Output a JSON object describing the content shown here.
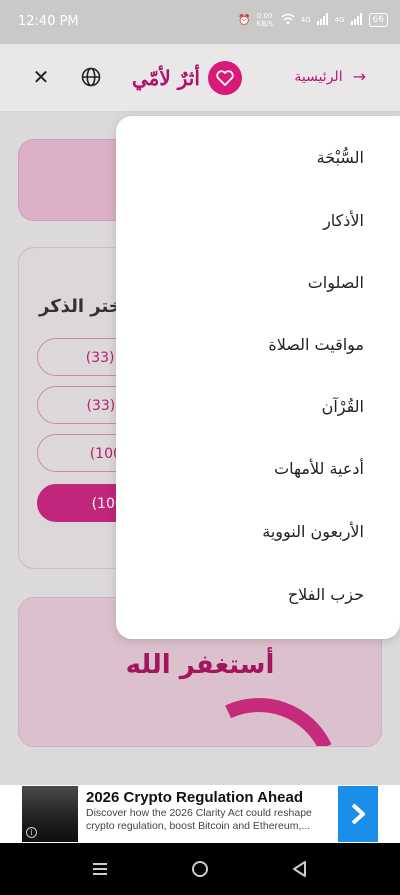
{
  "status_bar": {
    "time": "12:40 PM",
    "data_speed": "0.00 KB/S",
    "signal1": "4G",
    "signal2": "4G",
    "battery": "66"
  },
  "header": {
    "app_name": "أثرٌ لأمّي",
    "home_label": "الرئيسية",
    "brand_color": "#d81b79"
  },
  "background": {
    "choose_dhikr": "اختر الذكر",
    "pills": [
      {
        "label": "ن الله (33)",
        "active": false
      },
      {
        "label": "ه أكبر (33)",
        "active": false
      },
      {
        "label": "مده (100)",
        "active": false
      },
      {
        "label": "الله (100)",
        "active": true
      }
    ],
    "current_dhikr": "أستغفر الله"
  },
  "menu": {
    "items": [
      "السُّبْحَة",
      "الأذكار",
      "الصلوات",
      "مواقيت الصلاة",
      "القُرْآن",
      "أدعية للأمهات",
      "الأربعون النووية",
      "حزب الفلاح"
    ]
  },
  "ad": {
    "title": "2026 Crypto Regulation Ahead",
    "description": "Discover how the 2026 Clarity Act could reshape crypto regulation, boost Bitcoin and Ethereum,...",
    "accent": "#1a8ee8"
  },
  "nav_icons": [
    "recent-apps-icon",
    "home-icon",
    "back-icon"
  ]
}
